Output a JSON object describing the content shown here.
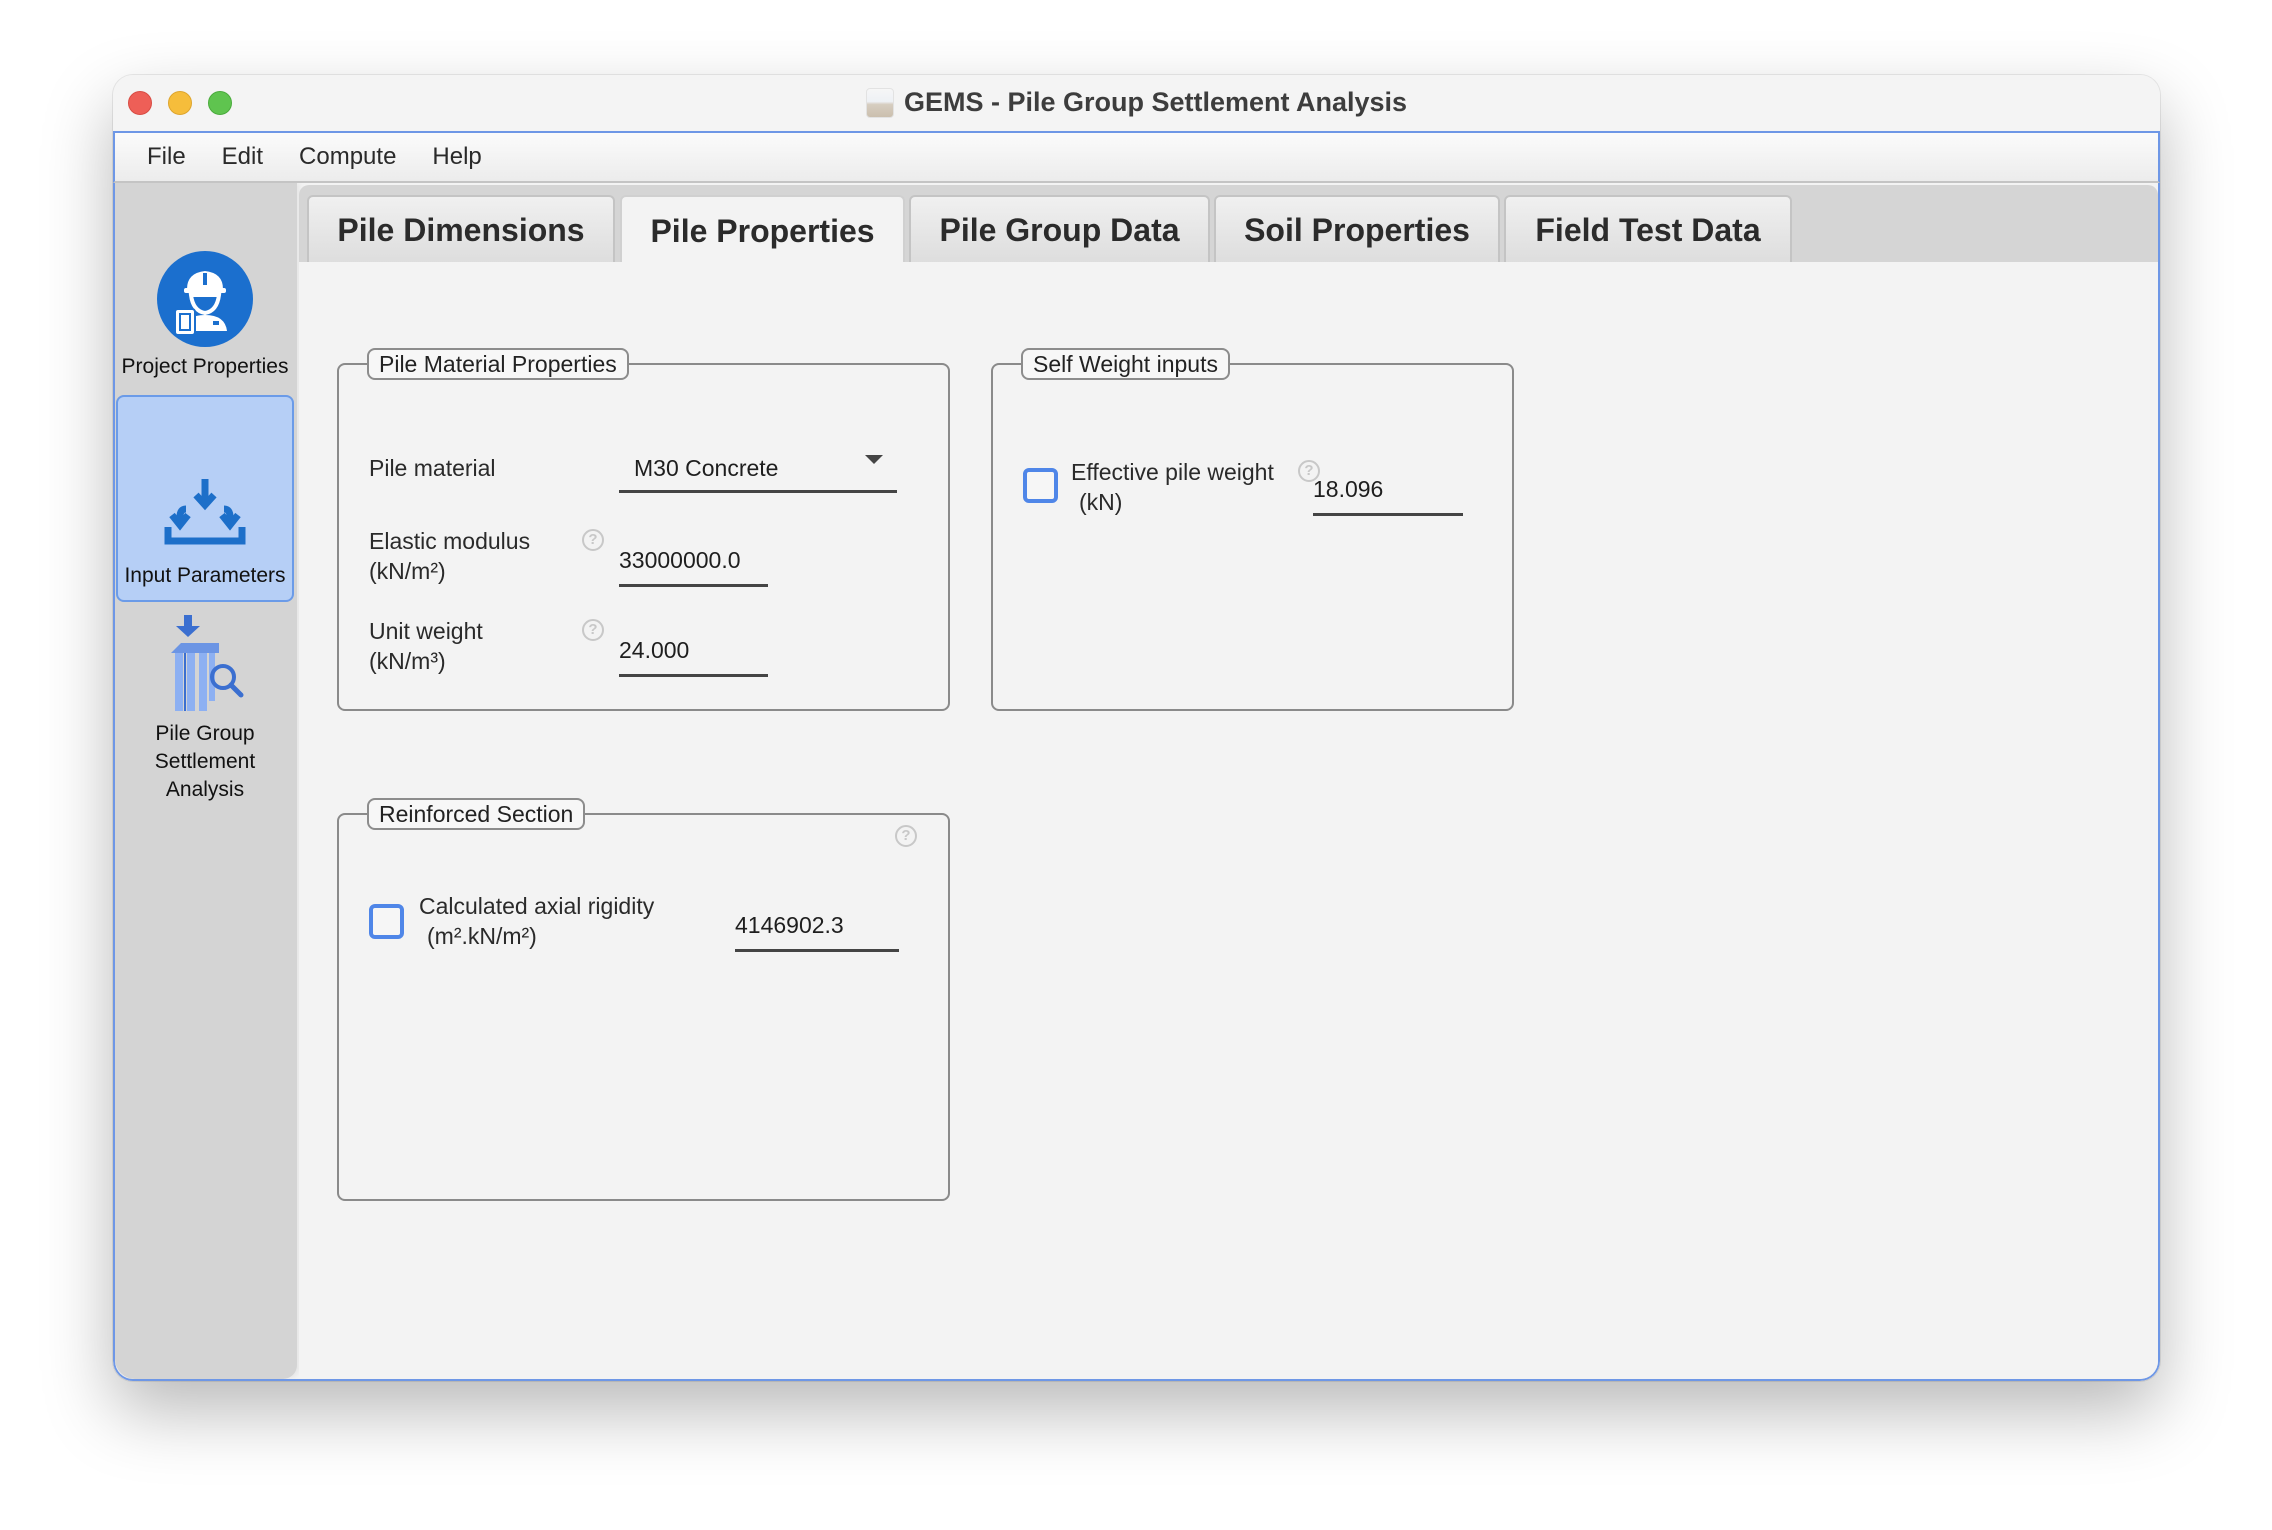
{
  "window": {
    "title": "GEMS - Pile Group Settlement Analysis",
    "app_icon": "app-icon"
  },
  "menu": [
    "File",
    "Edit",
    "Compute",
    "Help"
  ],
  "sidebar": {
    "items": [
      {
        "label": "Project Properties",
        "icon": "engineer-icon",
        "active": false
      },
      {
        "label": "Input Parameters",
        "icon": "input-download-icon",
        "active": true
      },
      {
        "label_lines": [
          "Pile Group",
          "Settlement",
          "Analysis"
        ],
        "icon": "pile-group-analysis-icon",
        "active": false
      }
    ],
    "active_color": "#b6cff6",
    "accent_color": "#1b6fce"
  },
  "tabs": [
    {
      "label": "Pile Dimensions",
      "active": false
    },
    {
      "label": "Pile Properties",
      "active": true
    },
    {
      "label": "Pile Group Data",
      "active": false
    },
    {
      "label": "Soil Properties",
      "active": false
    },
    {
      "label": "Field Test Data",
      "active": false
    }
  ],
  "pile_material_panel": {
    "title": "Pile Material Properties",
    "pile_material": {
      "label": "Pile material",
      "value": "M30 Concrete"
    },
    "elastic_modulus": {
      "label": "Elastic modulus",
      "unit": "(kN/m²)",
      "value": "33000000.0",
      "help": "?"
    },
    "unit_weight": {
      "label": "Unit weight",
      "unit": "(kN/m³)",
      "value": "24.000",
      "help": "?"
    }
  },
  "self_weight_panel": {
    "title": "Self Weight inputs",
    "effective_pile_weight": {
      "label": "Effective pile weight",
      "unit": "(kN)",
      "value": "18.096",
      "checked": false,
      "help": "?"
    }
  },
  "reinforced_section_panel": {
    "title": "Reinforced Section",
    "help": "?",
    "axial_rigidity": {
      "label": "Calculated axial rigidity",
      "unit": "(m².kN/m²)",
      "value": "4146902.3",
      "checked": false
    }
  }
}
